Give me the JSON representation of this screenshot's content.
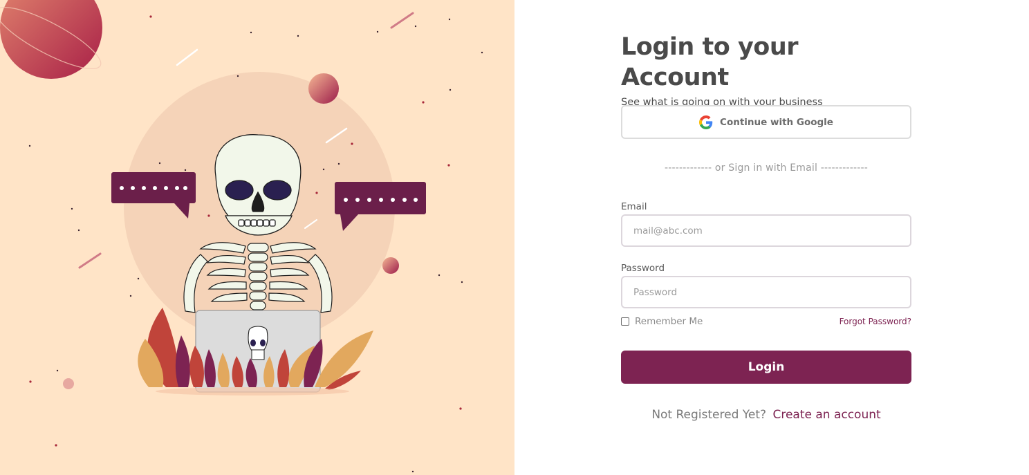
{
  "login": {
    "title": "Login to your Account",
    "subtitle": "See what is going on with your business",
    "google_button_label": "Continue with Google",
    "divider_text": "------------- or Sign in with Email -------------",
    "email_label": "Email",
    "email_placeholder": "mail@abc.com",
    "password_label": "Password",
    "password_placeholder": "Password",
    "remember_label": "Remember Me",
    "forgot_label": "Forgot Password?",
    "login_button_label": "Login",
    "not_registered_text": "Not Registered Yet?",
    "create_account_label": "Create an account"
  },
  "illustration": {
    "description_icons": [
      "skeleton-illustration",
      "laptop-icon",
      "speech-bubble-icon",
      "planet-icon"
    ]
  },
  "colors": {
    "accent": "#7d2352",
    "left_background": "#ffe4c7",
    "speech_bubble": "#6b1f4a"
  }
}
